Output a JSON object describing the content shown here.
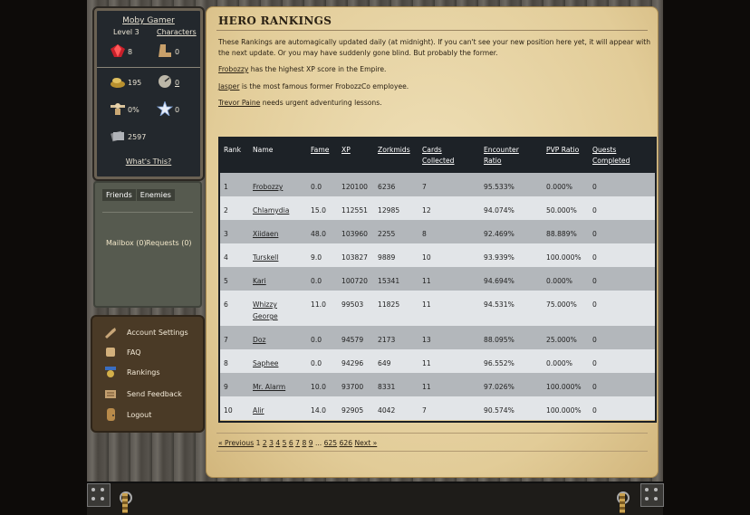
{
  "profile": {
    "name": "Moby Gamer",
    "level": "Level 3",
    "characters_link": "Characters",
    "gems": "8",
    "boots": "0",
    "gold": "195",
    "timer": "0",
    "strength": "0%",
    "stars": "0",
    "cards": "2597",
    "whats_this": "What's This?"
  },
  "social": {
    "tab_friends": "Friends",
    "tab_enemies": "Enemies",
    "mailbox": "Mailbox (0)",
    "requests": "Requests (0)"
  },
  "menu": {
    "items": [
      "Account Settings",
      "FAQ",
      "Rankings",
      "Send Feedback",
      "Logout"
    ]
  },
  "page": {
    "title": "HERO RANKINGS",
    "intro": "These Rankings are automagically updated daily (at midnight). If you can't see your new position here yet, it will appear with the next update. Or you may have suddenly gone blind. But probably the former.",
    "facts": [
      {
        "name": "Frobozzy",
        "text": " has the highest XP score in the Empire."
      },
      {
        "name": "Jasper",
        "text": " is the most famous former FrobozzCo employee."
      },
      {
        "name": "Trevor Paine",
        "text": " needs urgent adventuring lessons."
      }
    ]
  },
  "table": {
    "headers": {
      "rank": "Rank",
      "name": "Name",
      "fame": "Fame",
      "xp": "XP",
      "zorkmids": "Zorkmids",
      "cards_1": "Cards",
      "cards_2": "Collected",
      "enc_1": "Encounter",
      "enc_2": "Ratio",
      "pvp": "PVP Ratio",
      "quests_1": "Quests",
      "quests_2": "Completed"
    },
    "rows": [
      {
        "rank": "1",
        "name": "Frobozzy",
        "name2": "",
        "fame": "0.0",
        "xp": "120100",
        "zorkmids": "6236",
        "cards": "7",
        "enc": "95.533%",
        "pvp": "0.000%",
        "quests": "0"
      },
      {
        "rank": "2",
        "name": "Chlamydia",
        "name2": "",
        "fame": "15.0",
        "xp": "112551",
        "zorkmids": "12985",
        "cards": "12",
        "enc": "94.074%",
        "pvp": "50.000%",
        "quests": "0"
      },
      {
        "rank": "3",
        "name": "Xiidaen",
        "name2": "",
        "fame": "48.0",
        "xp": "103960",
        "zorkmids": "2255",
        "cards": "8",
        "enc": "92.469%",
        "pvp": "88.889%",
        "quests": "0"
      },
      {
        "rank": "4",
        "name": "Turskell",
        "name2": "",
        "fame": "9.0",
        "xp": "103827",
        "zorkmids": "9889",
        "cards": "10",
        "enc": "93.939%",
        "pvp": "100.000%",
        "quests": "0"
      },
      {
        "rank": "5",
        "name": "Kari",
        "name2": "",
        "fame": "0.0",
        "xp": "100720",
        "zorkmids": "15341",
        "cards": "11",
        "enc": "94.694%",
        "pvp": "0.000%",
        "quests": "0"
      },
      {
        "rank": "6",
        "name": "Whizzy",
        "name2": "George",
        "fame": "11.0",
        "xp": "99503",
        "zorkmids": "11825",
        "cards": "11",
        "enc": "94.531%",
        "pvp": "75.000%",
        "quests": "0"
      },
      {
        "rank": "7",
        "name": "Doz",
        "name2": "",
        "fame": "0.0",
        "xp": "94579",
        "zorkmids": "2173",
        "cards": "13",
        "enc": "88.095%",
        "pvp": "25.000%",
        "quests": "0"
      },
      {
        "rank": "8",
        "name": "Saphee",
        "name2": "",
        "fame": "0.0",
        "xp": "94296",
        "zorkmids": "649",
        "cards": "11",
        "enc": "96.552%",
        "pvp": "0.000%",
        "quests": "0"
      },
      {
        "rank": "9",
        "name": "Mr. Alarm",
        "name2": "",
        "fame": "10.0",
        "xp": "93700",
        "zorkmids": "8331",
        "cards": "11",
        "enc": "97.026%",
        "pvp": "100.000%",
        "quests": "0"
      },
      {
        "rank": "10",
        "name": "Alir",
        "name2": "",
        "fame": "14.0",
        "xp": "92905",
        "zorkmids": "4042",
        "cards": "7",
        "enc": "90.574%",
        "pvp": "100.000%",
        "quests": "0"
      }
    ]
  },
  "pagination": {
    "previous": "« Previous",
    "current": "1",
    "pages": [
      "2",
      "3",
      "4",
      "5",
      "6",
      "7",
      "8",
      "9"
    ],
    "ellipsis": "...",
    "tail": [
      "625",
      "626"
    ],
    "next": "Next »"
  }
}
